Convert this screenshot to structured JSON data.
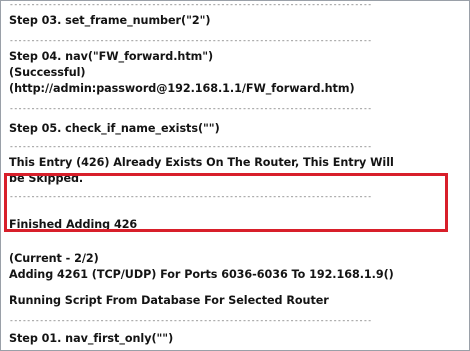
{
  "log": {
    "step03": "Step 03. set_frame_number(\"2\")",
    "step04": "Step 04. nav(\"FW_forward.htm\")",
    "step04_status": "(Successful)",
    "step04_url": "(http://admin:password@192.168.1.1/FW_forward.htm)",
    "step05": "Step 05. check_if_name_exists(\"\")",
    "entry_line1": "This Entry (426) Already Exists On The Router, This Entry Will",
    "entry_line2": "be Skipped.",
    "finished": "Finished Adding 426",
    "current": "(Current -  2/2)",
    "adding": "Adding 4261 (TCP/UDP) For Ports 6036-6036 To 192.168.1.9()",
    "running": "Running Script From Database For Selected Router",
    "step01_partial": "Step 01. nav_first_only(\"\")",
    "separator": "------------------------------------------------------------------------------------"
  },
  "colors": {
    "highlight": "#d81f2a",
    "text": "#141414"
  }
}
